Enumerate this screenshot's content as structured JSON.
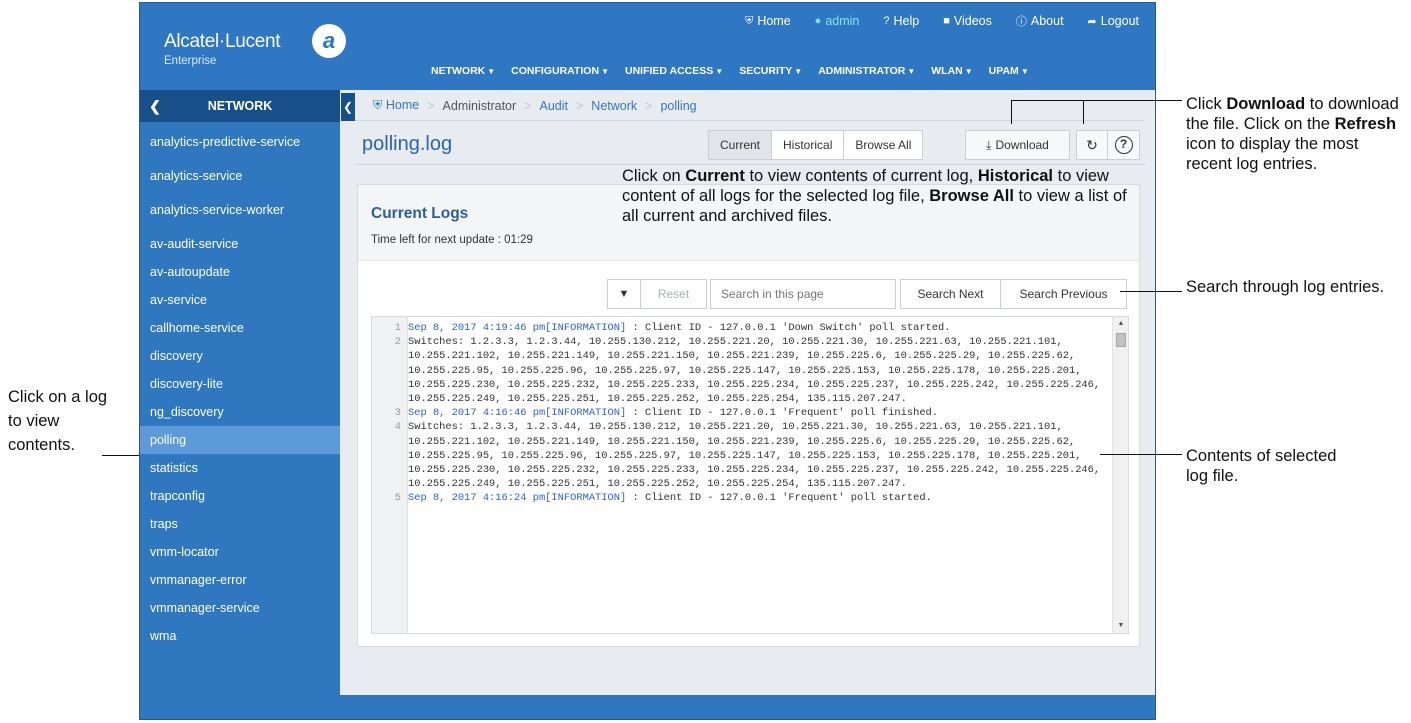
{
  "brand": {
    "name": "Alcatel·Lucent",
    "sub": "Enterprise"
  },
  "util_nav": {
    "home": "Home",
    "admin": "admin",
    "help": "Help",
    "videos": "Videos",
    "about": "About",
    "logout": "Logout"
  },
  "main_nav": [
    "NETWORK",
    "CONFIGURATION",
    "UNIFIED ACCESS",
    "SECURITY",
    "ADMINISTRATOR",
    "WLAN",
    "UPAM"
  ],
  "sidebar": {
    "title": "NETWORK",
    "items": [
      "analytics-predictive-service",
      "analytics-service",
      "analytics-service-worker",
      "av-audit-service",
      "av-autoupdate",
      "av-service",
      "callhome-service",
      "discovery",
      "discovery-lite",
      "ng_discovery",
      "polling",
      "statistics",
      "trapconfig",
      "traps",
      "vmm-locator",
      "vmmanager-error",
      "vmmanager-service",
      "wma"
    ],
    "active": "polling"
  },
  "breadcrumb": [
    "Home",
    "Administrator",
    "Audit",
    "Network",
    "polling"
  ],
  "page": {
    "title": "polling.log",
    "view_tabs": [
      "Current",
      "Historical",
      "Browse All"
    ],
    "download_label": "Download"
  },
  "panel": {
    "title": "Current Logs",
    "timer": "Time left for next update : 01:29",
    "reset_label": "Reset",
    "search_placeholder": "Search in this page",
    "search_next": "Search Next",
    "search_prev": "Search Previous"
  },
  "log": [
    {
      "n": "1",
      "stamp": "Sep 8, 2017 4:19:46 pm[INFORMATION]",
      "rest": " : Client ID - 127.0.0.1 'Down Switch' poll started."
    },
    {
      "n": "2",
      "stamp": "",
      "rest": "Switches: 1.2.3.3, 1.2.3.44, 10.255.130.212, 10.255.221.20, 10.255.221.30, 10.255.221.63, 10.255.221.101, 10.255.221.102, 10.255.221.149, 10.255.221.150, 10.255.221.239, 10.255.225.6, 10.255.225.29, 10.255.225.62, 10.255.225.95, 10.255.225.96, 10.255.225.97, 10.255.225.147, 10.255.225.153, 10.255.225.178, 10.255.225.201, 10.255.225.230, 10.255.225.232, 10.255.225.233, 10.255.225.234, 10.255.225.237, 10.255.225.242, 10.255.225.246, 10.255.225.249, 10.255.225.251, 10.255.225.252, 10.255.225.254, 135.115.207.247."
    },
    {
      "n": "3",
      "stamp": "Sep 8, 2017 4:16:46 pm[INFORMATION]",
      "rest": " : Client ID - 127.0.0.1 'Frequent' poll finished."
    },
    {
      "n": "4",
      "stamp": "",
      "rest": "Switches: 1.2.3.3, 1.2.3.44, 10.255.130.212, 10.255.221.20, 10.255.221.30, 10.255.221.63, 10.255.221.101, 10.255.221.102, 10.255.221.149, 10.255.221.150, 10.255.221.239, 10.255.225.6, 10.255.225.29, 10.255.225.62, 10.255.225.95, 10.255.225.96, 10.255.225.97, 10.255.225.147, 10.255.225.153, 10.255.225.178, 10.255.225.201, 10.255.225.230, 10.255.225.232, 10.255.225.233, 10.255.225.234, 10.255.225.237, 10.255.225.242, 10.255.225.246, 10.255.225.249, 10.255.225.251, 10.255.225.252, 10.255.225.254, 135.115.207.247."
    },
    {
      "n": "5",
      "stamp": "Sep 8, 2017 4:16:24 pm[INFORMATION]",
      "rest": " : Client ID - 127.0.0.1 'Frequent' poll started."
    }
  ],
  "annotations": {
    "download": {
      "a": "Click ",
      "b": "Download",
      "c": " to download the file. Click on the ",
      "d": "Refresh",
      "e": " icon to display the most recent log entries."
    },
    "current": {
      "a": "Click on ",
      "b": "Current",
      "c": " to view contents of current log, ",
      "d": "Historical",
      "e": " to view content of all logs for the selected log file, ",
      "f": "Browse All",
      "g": " to view a list of all current and archived files."
    },
    "search": "Search through log entries.",
    "contents": "Contents of selected log file.",
    "click_log": "Click on a log to view contents."
  },
  "colors": {
    "header": "#2f77c2",
    "sidebar": "#2f78c0",
    "sidebar_active": "#5c9ad9",
    "link": "#2b5fd6"
  }
}
